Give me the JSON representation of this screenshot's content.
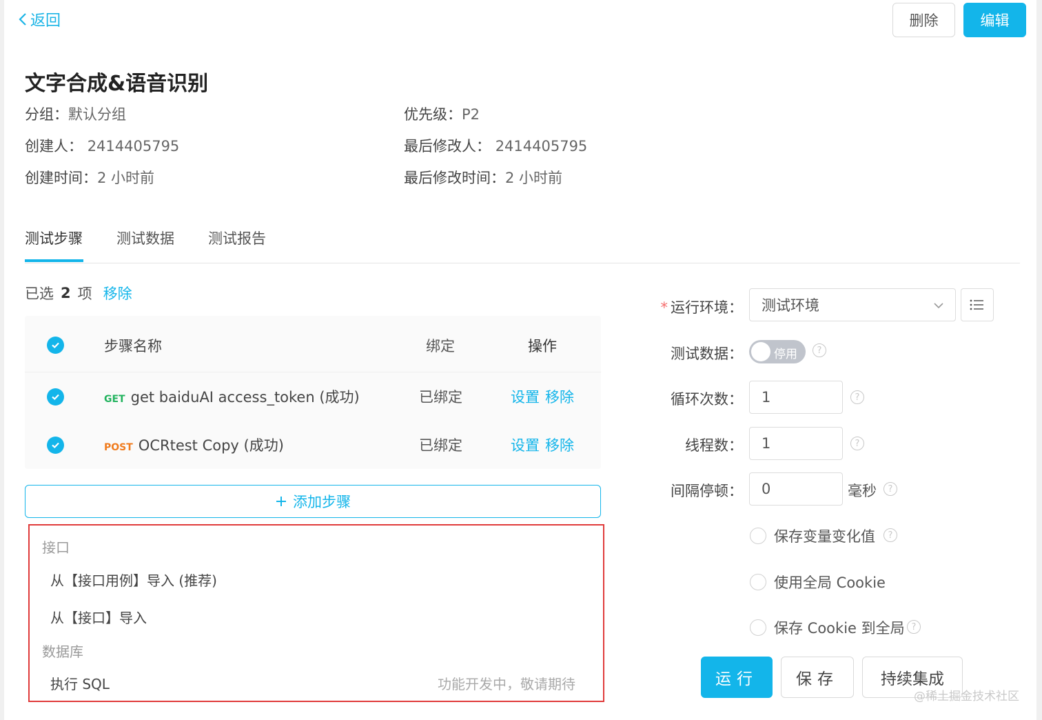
{
  "nav": {
    "back_label": "返回",
    "delete_label": "删除",
    "edit_label": "编辑"
  },
  "case": {
    "title": "文字合成&语音识别",
    "group_label": "分组：",
    "group_value": "默认分组",
    "priority_label": "优先级：",
    "priority_value": "P2",
    "creator_label": "创建人：",
    "creator_value": "2414405795",
    "modifier_label": "最后修改人：",
    "modifier_value": "2414405795",
    "created_label": "创建时间：",
    "created_value": "2 小时前",
    "modified_label": "最后修改时间：",
    "modified_value": "2 小时前"
  },
  "tabs": [
    {
      "label": "测试步骤",
      "active": true
    },
    {
      "label": "测试数据",
      "active": false
    },
    {
      "label": "测试报告",
      "active": false
    }
  ],
  "selection": {
    "prefix": "已选",
    "count": "2",
    "suffix": "项",
    "remove_label": "移除"
  },
  "steps_table": {
    "headers": {
      "name": "步骤名称",
      "bind": "绑定",
      "op": "操作"
    },
    "rows": [
      {
        "method": "GET",
        "name": "get baiduAI access_token (成功)",
        "bind": "已绑定",
        "set": "设置",
        "remove": "移除",
        "checked": true
      },
      {
        "method": "POST",
        "name": "OCRtest Copy (成功)",
        "bind": "已绑定",
        "set": "设置",
        "remove": "移除",
        "checked": true
      }
    ]
  },
  "add_step": {
    "icon": "plus-icon",
    "label": "添加步骤"
  },
  "add_menu": {
    "group_api": "接口",
    "item_case": "从【接口用例】导入 (推荐)",
    "item_api": "从【接口】导入",
    "group_db": "数据库",
    "item_sql": "执行 SQL",
    "sql_hint": "功能开发中，敬请期待"
  },
  "run_form": {
    "env_label": "运行环境：",
    "env_value": "测试环境",
    "required_mark": "*",
    "data_label": "测试数据：",
    "data_toggle": "停用",
    "data_enabled": false,
    "loop_label": "循环次数：",
    "loop_value": "1",
    "thread_label": "线程数：",
    "thread_value": "1",
    "interval_label": "间隔停顿：",
    "interval_value": "0",
    "interval_unit": "毫秒",
    "save_var": "保存变量变化值",
    "global_cookie": "使用全局 Cookie",
    "save_cookie": "保存 Cookie 到全局",
    "help_symbol": "?"
  },
  "actions": {
    "run": "运行",
    "save": "保存",
    "ci": "持续集成"
  },
  "watermark": "@稀土掘金技术社区",
  "colors": {
    "accent": "#13b5ea",
    "get": "#22b35e",
    "post": "#f07b1d",
    "highlight": "#e03a3a"
  }
}
